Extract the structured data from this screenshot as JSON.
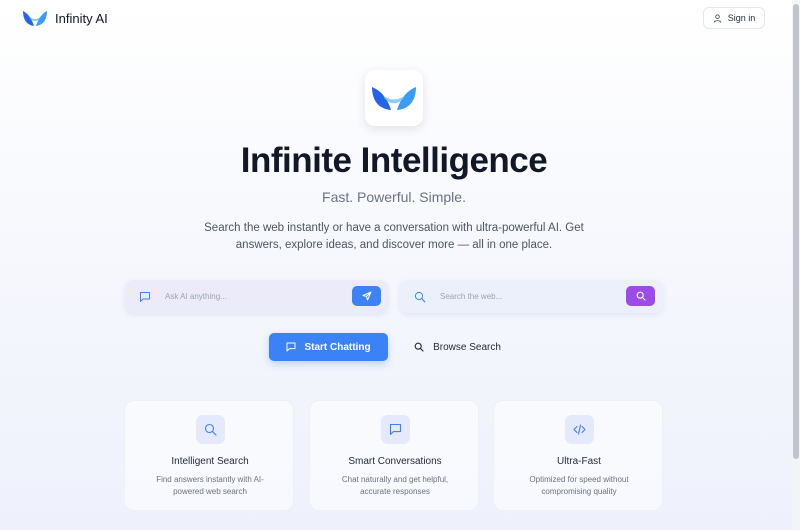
{
  "header": {
    "brand": "Infinity AI",
    "signin_label": "Sign in"
  },
  "hero": {
    "title": "Infinite Intelligence",
    "subtitle": "Fast. Powerful. Simple.",
    "description": "Search the web instantly or have a conversation with ultra-powerful AI. Get answers, explore ideas, and discover more — all in one place."
  },
  "chat_box": {
    "placeholder": "Ask AI anything..."
  },
  "search_box": {
    "placeholder": "Search the web..."
  },
  "actions": {
    "start_label": "Start Chatting",
    "browse_label": "Browse Search"
  },
  "features": [
    {
      "icon": "search-icon",
      "title": "Intelligent Search",
      "description": "Find answers instantly with AI-powered web search"
    },
    {
      "icon": "message-icon",
      "title": "Smart Conversations",
      "description": "Chat naturally and get helpful, accurate responses"
    },
    {
      "icon": "code-icon",
      "title": "Ultra-Fast",
      "description": "Optimized for speed without compromising quality"
    }
  ],
  "colors": {
    "primary_blue": "#3b82f6",
    "accent_purple": "#9d4be8",
    "logo_light_blue": "#7cc8fb"
  }
}
